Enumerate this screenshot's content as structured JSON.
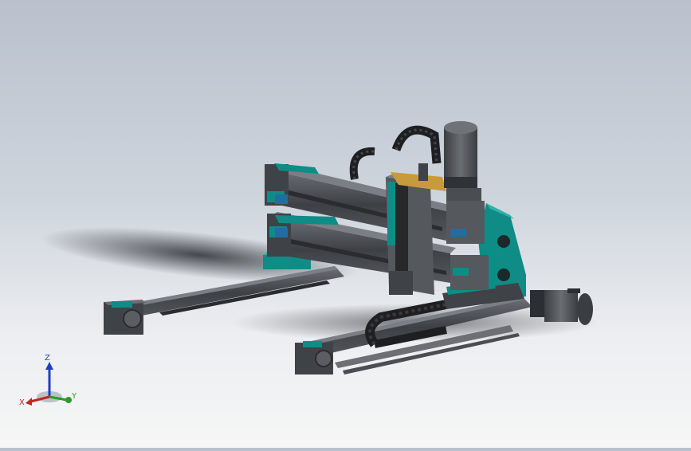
{
  "view": {
    "background_top": "#b9c1cd",
    "background_bottom": "#f6f6f6"
  },
  "model": {
    "accent_color": "#0f8c86",
    "body_color": "#4a4d52",
    "motor_color": "#5b5e63",
    "cable_chain_color": "#1f1f22",
    "plate_color": "#c79a3c"
  },
  "triad": {
    "x_label": "X",
    "y_label": "Y",
    "z_label": "Z",
    "x_color": "#c0271f",
    "y_color": "#2a9a2a",
    "z_color": "#1f3fbf"
  }
}
